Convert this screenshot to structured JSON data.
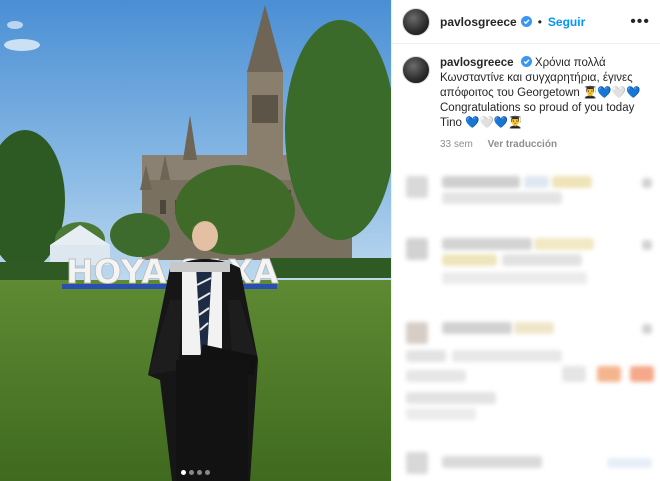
{
  "post": {
    "username": "pavlosgreece",
    "dot": "•",
    "follow_label": "Seguir",
    "more_label": "•••",
    "caption_text": "Χρόνια πολλά Κωνσταντίνε και συγχαρητήρια, έγινες απόφοιτος του Georgetown 👨‍🎓💙🤍💙 Congratulations so proud of you today Tino 💙🤍💙👨‍🎓",
    "time_ago": "33 sem",
    "translate_label": "Ver traducción"
  },
  "photo": {
    "sign_text": "HOYA SAXA",
    "carousel_dots": 4,
    "active_dot": 0
  },
  "colors": {
    "link": "#0095f6",
    "verified": "#3897f0",
    "muted": "#8e8e8e"
  },
  "icons": [
    "verified-badge-icon",
    "more-options-icon"
  ]
}
